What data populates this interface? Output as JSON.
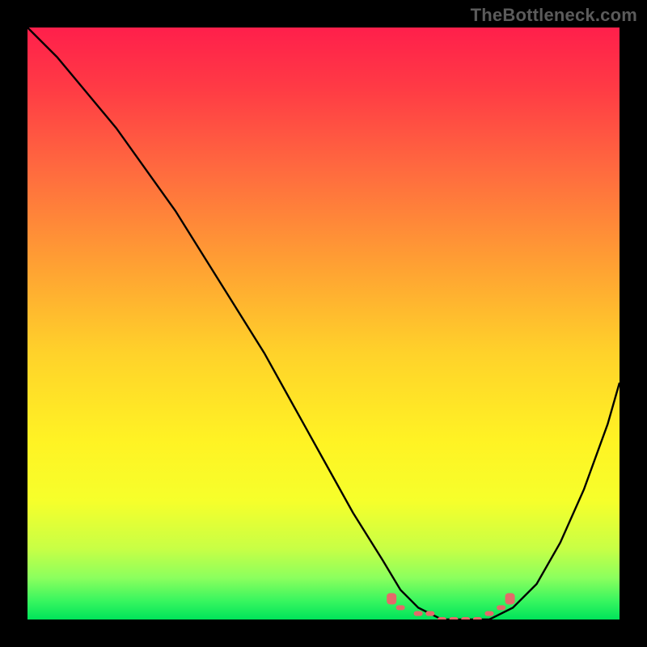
{
  "watermark": "TheBottleneck.com",
  "chart_data": {
    "type": "line",
    "title": "",
    "xlabel": "",
    "ylabel": "",
    "ylim": [
      0,
      100
    ],
    "xlim": [
      0,
      100
    ],
    "series": [
      {
        "name": "main-curve",
        "x": [
          0,
          5,
          10,
          15,
          20,
          25,
          30,
          35,
          40,
          45,
          50,
          55,
          60,
          63,
          66,
          70,
          74,
          78,
          82,
          86,
          90,
          94,
          98,
          100
        ],
        "values": [
          100,
          95,
          89,
          83,
          76,
          69,
          61,
          53,
          45,
          36,
          27,
          18,
          10,
          5,
          2,
          0,
          0,
          0,
          2,
          6,
          13,
          22,
          33,
          40
        ]
      },
      {
        "name": "flat-markers",
        "x": [
          63,
          66,
          68,
          70,
          72,
          74,
          76,
          78,
          80
        ],
        "values": [
          2,
          1,
          1,
          0,
          0,
          0,
          0,
          1,
          2
        ]
      }
    ],
    "gradient_stops": [
      {
        "pos": 0,
        "color": "#ff1f4b"
      },
      {
        "pos": 10,
        "color": "#ff3a45"
      },
      {
        "pos": 24,
        "color": "#ff6a3f"
      },
      {
        "pos": 40,
        "color": "#ffa033"
      },
      {
        "pos": 55,
        "color": "#ffd22a"
      },
      {
        "pos": 70,
        "color": "#fff324"
      },
      {
        "pos": 80,
        "color": "#f6ff2b"
      },
      {
        "pos": 88,
        "color": "#c8ff45"
      },
      {
        "pos": 93,
        "color": "#8bff5e"
      },
      {
        "pos": 97,
        "color": "#35f55f"
      },
      {
        "pos": 100,
        "color": "#00e35a"
      }
    ],
    "marker_color": "#e46a6a",
    "curve_color": "#000000"
  }
}
